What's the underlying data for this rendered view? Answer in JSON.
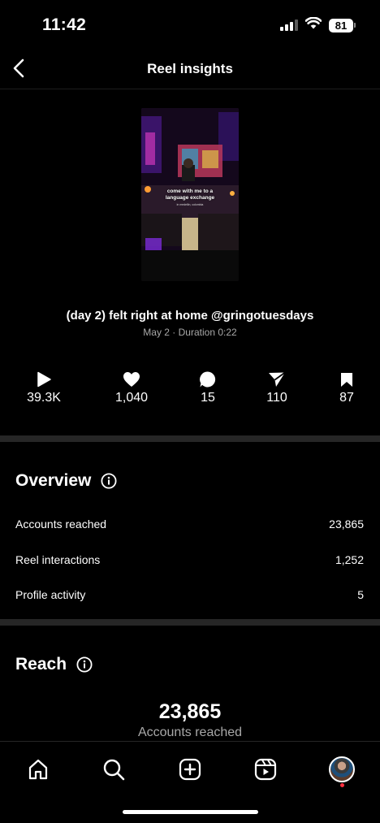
{
  "status_bar": {
    "time": "11:42",
    "battery": "81"
  },
  "header": {
    "title": "Reel insights"
  },
  "reel": {
    "thumbnail_text": "come with me to a language exchange",
    "thumbnail_subtext": "in medellin, colombia",
    "caption": "(day 2) felt right at home @gringotuesdays",
    "meta": "May 2 · Duration 0:22"
  },
  "stats": [
    {
      "icon": "play-icon",
      "value": "39.3K"
    },
    {
      "icon": "heart-icon",
      "value": "1,040"
    },
    {
      "icon": "comment-icon",
      "value": "15"
    },
    {
      "icon": "share-icon",
      "value": "110"
    },
    {
      "icon": "bookmark-icon",
      "value": "87"
    }
  ],
  "overview": {
    "title": "Overview",
    "rows": [
      {
        "label": "Accounts reached",
        "value": "23,865"
      },
      {
        "label": "Reel interactions",
        "value": "1,252"
      },
      {
        "label": "Profile activity",
        "value": "5"
      }
    ]
  },
  "reach": {
    "title": "Reach",
    "value": "23,865",
    "label": "Accounts reached"
  },
  "bottom_nav": [
    "home-icon",
    "search-icon",
    "create-icon",
    "reels-icon",
    "profile-avatar"
  ],
  "colors": {
    "background": "#000000",
    "secondary_text": "#a8a8a8",
    "divider": "#262626",
    "notification": "#ff3040"
  }
}
